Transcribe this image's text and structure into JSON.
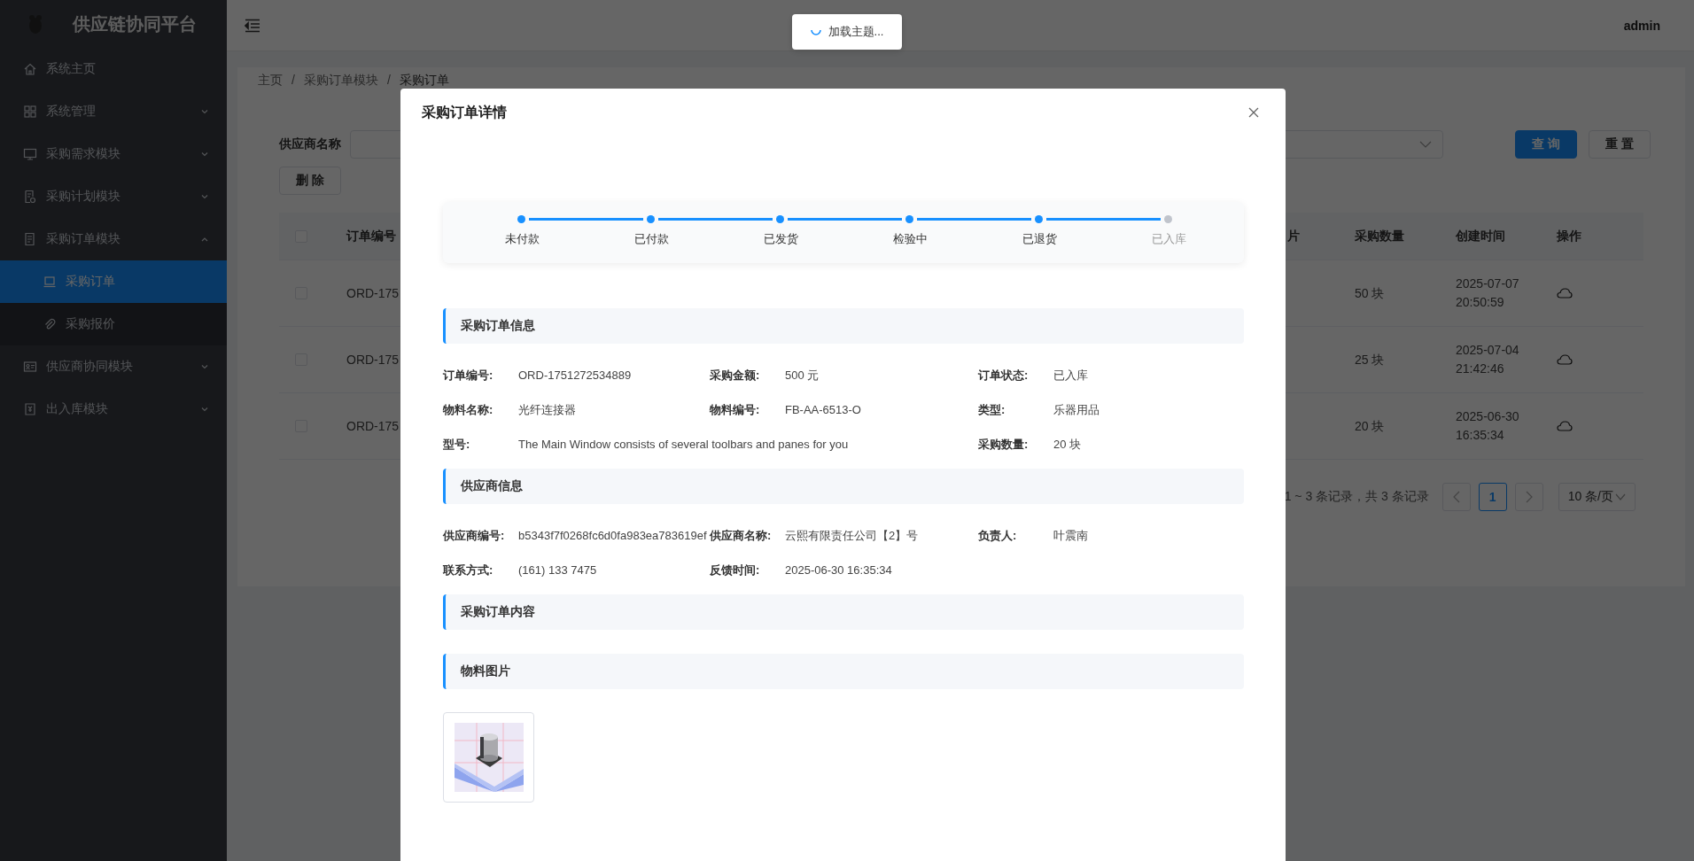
{
  "sidebar": {
    "title": "供应链协同平台",
    "items": [
      {
        "label": "系统主页",
        "selected": false
      },
      {
        "label": "系统管理",
        "selected": false,
        "expanded": false
      },
      {
        "label": "采购需求模块",
        "selected": false,
        "expanded": false
      },
      {
        "label": "采购计划模块",
        "selected": false,
        "expanded": false
      },
      {
        "label": "采购订单模块",
        "selected": false,
        "expanded": true,
        "children": [
          {
            "label": "采购订单",
            "selected": true
          },
          {
            "label": "采购报价",
            "selected": false
          }
        ]
      },
      {
        "label": "供应商协同模块",
        "selected": false,
        "expanded": false
      },
      {
        "label": "出入库模块",
        "selected": false,
        "expanded": false
      }
    ]
  },
  "header": {
    "user": "admin"
  },
  "toast": {
    "text": "加载主题..."
  },
  "breadcrumb": [
    {
      "text": "主页",
      "kind": "link"
    },
    {
      "text": "/",
      "kind": "separator"
    },
    {
      "text": "采购订单模块",
      "kind": "link"
    },
    {
      "text": "/",
      "kind": "separator"
    },
    {
      "text": "采购订单",
      "kind": "current"
    }
  ],
  "filters": {
    "label": "供应商名称",
    "buttons": [
      {
        "label": "查 询",
        "kind": "primary"
      },
      {
        "label": "重 置",
        "kind": "plain"
      }
    ]
  },
  "toolbar": {
    "buttons": [
      "删 除"
    ]
  },
  "table": {
    "columns": [
      "订单编号",
      "片",
      "采购数量",
      "创建时间",
      "操作"
    ],
    "rows": [
      {
        "checked": false,
        "cells": [
          "ORD-175",
          "",
          "50 块",
          "2025-07-07 20:50:59"
        ]
      },
      {
        "checked": false,
        "cells": [
          "ORD-175",
          "",
          "25 块",
          "2025-07-04 21:42:46"
        ]
      },
      {
        "checked": false,
        "cells": [
          "ORD-175",
          "",
          "20 块",
          "2025-06-30 16:35:34"
        ]
      }
    ],
    "header_checked": false
  },
  "pagination": {
    "summary": "1 ~ 3 条记录，共 3 条记录",
    "pages": [
      {
        "label": "1",
        "selected": true
      }
    ],
    "page_size": "10 条/页"
  },
  "modal": {
    "title": "采购订单详情",
    "steps": [
      {
        "label": "未付款",
        "done": true
      },
      {
        "label": "已付款",
        "done": true
      },
      {
        "label": "已发货",
        "done": true
      },
      {
        "label": "检验中",
        "done": true
      },
      {
        "label": "已退货",
        "done": true
      },
      {
        "label": "已入库",
        "done": false
      }
    ],
    "sections": [
      {
        "title": "采购订单信息",
        "kind": "fields",
        "fields": [
          {
            "label": "订单编号:",
            "value": "ORD-1751272534889",
            "kind": "normal"
          },
          {
            "label": "采购金额:",
            "value": "500 元",
            "kind": "normal"
          },
          {
            "label": "订单状态:",
            "value": "已入库",
            "kind": "normal"
          },
          {
            "label": "物料名称:",
            "value": "光纤连接器",
            "kind": "normal"
          },
          {
            "label": "物料编号:",
            "value": "FB-AA-6513-O",
            "kind": "normal"
          },
          {
            "label": "类型:",
            "value": "乐器用品",
            "kind": "normal"
          },
          {
            "label": "型号:",
            "value": "The Main Window consists of several toolbars and panes for you",
            "kind": "wide"
          },
          {
            "label": "采购数量:",
            "value": "20 块",
            "kind": "normal"
          }
        ]
      },
      {
        "title": "供应商信息",
        "kind": "fields",
        "fields": [
          {
            "label": "供应商编号:",
            "value": "b5343f7f0268fc6d0fa983ea783619ef",
            "kind": "normal"
          },
          {
            "label": "供应商名称:",
            "value": "云熙有限责任公司【2】号",
            "kind": "normal"
          },
          {
            "label": "负责人:",
            "value": "叶震南",
            "kind": "normal"
          },
          {
            "label": "联系方式:",
            "value": "(161) 133 7475",
            "kind": "normal"
          },
          {
            "label": "反馈时间:",
            "value": "2025-06-30 16:35:34",
            "kind": "normal"
          }
        ]
      },
      {
        "title": "采购订单内容",
        "kind": "empty"
      },
      {
        "title": "物料图片",
        "kind": "images"
      }
    ]
  }
}
